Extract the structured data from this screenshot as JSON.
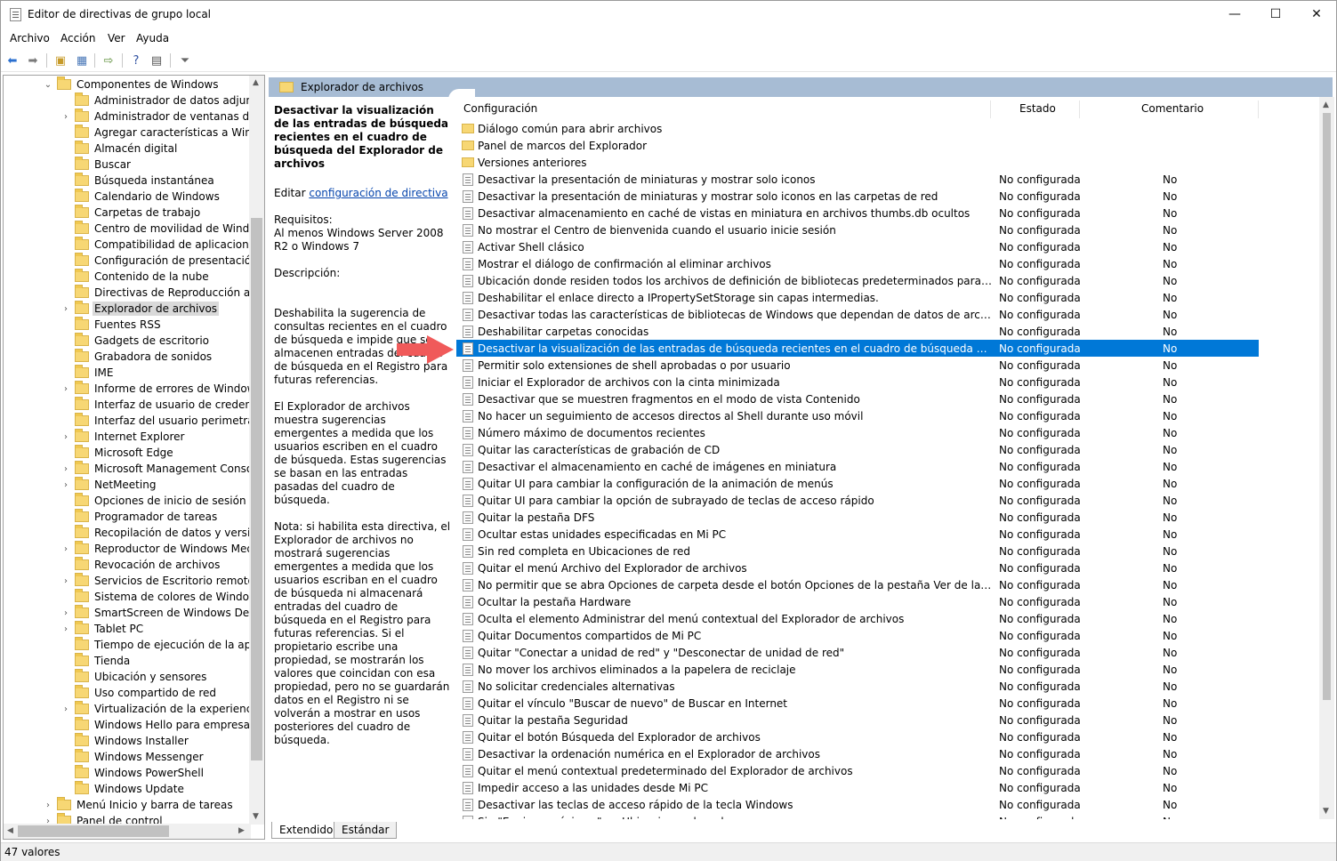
{
  "window": {
    "title": "Editor de directivas de grupo local",
    "minimize": "—",
    "maximize": "☐",
    "close": "✕"
  },
  "menu": [
    "Archivo",
    "Acción",
    "Ver",
    "Ayuda"
  ],
  "tree": {
    "root": "Componentes de Windows",
    "items": [
      {
        "label": "Administrador de datos adjuntos",
        "expandable": false
      },
      {
        "label": "Administrador de ventanas del es",
        "expandable": true
      },
      {
        "label": "Agregar características a Window",
        "expandable": false
      },
      {
        "label": "Almacén digital",
        "expandable": false
      },
      {
        "label": "Buscar",
        "expandable": false
      },
      {
        "label": "Búsqueda instantánea",
        "expandable": false
      },
      {
        "label": "Calendario de Windows",
        "expandable": false
      },
      {
        "label": "Carpetas de trabajo",
        "expandable": false
      },
      {
        "label": "Centro de movilidad de Windows",
        "expandable": false
      },
      {
        "label": "Compatibilidad de aplicaciones",
        "expandable": false
      },
      {
        "label": "Configuración de presentación",
        "expandable": false
      },
      {
        "label": "Contenido de la nube",
        "expandable": false
      },
      {
        "label": "Directivas de Reproducción autor",
        "expandable": false
      },
      {
        "label": "Explorador de archivos",
        "expandable": true,
        "selected": true
      },
      {
        "label": "Fuentes RSS",
        "expandable": false
      },
      {
        "label": "Gadgets de escritorio",
        "expandable": false
      },
      {
        "label": "Grabadora de sonidos",
        "expandable": false
      },
      {
        "label": "IME",
        "expandable": false
      },
      {
        "label": "Informe de errores de Windows",
        "expandable": true
      },
      {
        "label": "Interfaz de usuario de credenciale",
        "expandable": false
      },
      {
        "label": "Interfaz del usuario perimetral",
        "expandable": false
      },
      {
        "label": "Internet Explorer",
        "expandable": true
      },
      {
        "label": "Microsoft Edge",
        "expandable": false
      },
      {
        "label": "Microsoft Management Console",
        "expandable": true
      },
      {
        "label": "NetMeeting",
        "expandable": true
      },
      {
        "label": "Opciones de inicio de sesión de V",
        "expandable": false
      },
      {
        "label": "Programador de tareas",
        "expandable": false
      },
      {
        "label": "Recopilación de datos y versiones",
        "expandable": false
      },
      {
        "label": "Reproductor de Windows Media",
        "expandable": true
      },
      {
        "label": "Revocación de archivos",
        "expandable": false
      },
      {
        "label": "Servicios de Escritorio remoto",
        "expandable": true
      },
      {
        "label": "Sistema de colores de Windows",
        "expandable": false
      },
      {
        "label": "SmartScreen de Windows Defend",
        "expandable": true
      },
      {
        "label": "Tablet PC",
        "expandable": true
      },
      {
        "label": "Tiempo de ejecución de la aplicac",
        "expandable": false
      },
      {
        "label": "Tienda",
        "expandable": false
      },
      {
        "label": "Ubicación y sensores",
        "expandable": false
      },
      {
        "label": "Uso compartido de red",
        "expandable": false
      },
      {
        "label": "Virtualización de la experiencia de",
        "expandable": true
      },
      {
        "label": "Windows Hello para empresas",
        "expandable": false
      },
      {
        "label": "Windows Installer",
        "expandable": false
      },
      {
        "label": "Windows Messenger",
        "expandable": false
      },
      {
        "label": "Windows PowerShell",
        "expandable": false
      },
      {
        "label": "Windows Update",
        "expandable": false
      }
    ],
    "siblings": [
      "Menú Inicio y barra de tareas",
      "Panel de control"
    ]
  },
  "header": {
    "title": "Explorador de archivos"
  },
  "description": {
    "title": "Desactivar la visualización de las entradas de búsqueda recientes en el cuadro de búsqueda del Explorador de archivos",
    "edit_prefix": "Editar ",
    "edit_link": "configuración de directiva",
    "req_label": "Requisitos:",
    "req_text": "Al menos Windows Server 2008 R2 o Windows 7",
    "desc_label": "Descripción:",
    "p1": "Deshabilita la sugerencia de consultas recientes en el cuadro de búsqueda e impide que se almacenen entradas del cuadro de búsqueda en el Registro para futuras referencias.",
    "p2": "El Explorador de archivos muestra sugerencias emergentes a medida que los usuarios escriben en el cuadro de búsqueda.  Estas sugerencias se basan en las entradas pasadas del cuadro de búsqueda.",
    "p3": "Nota: si habilita esta directiva, el Explorador de archivos no mostrará sugerencias emergentes a medida que los usuarios escriban en el cuadro de búsqueda ni almacenará entradas del cuadro de búsqueda en el Registro para futuras referencias.  Si el propietario escribe una propiedad, se mostrarán los valores que coincidan con esa propiedad, pero no se guardarán datos en el Registro ni se volverán a mostrar en usos posteriores del cuadro de búsqueda."
  },
  "columns": {
    "config": "Configuración",
    "estado": "Estado",
    "comentario": "Comentario"
  },
  "folders": [
    "Diálogo común para abrir archivos",
    "Panel de marcos del Explorador",
    "Versiones anteriores"
  ],
  "policies": [
    {
      "name": "Desactivar la presentación de miniaturas y mostrar solo iconos",
      "estado": "No configurada",
      "coment": "No"
    },
    {
      "name": "Desactivar la presentación de miniaturas y mostrar solo iconos en las carpetas de red",
      "estado": "No configurada",
      "coment": "No"
    },
    {
      "name": "Desactivar almacenamiento en caché de vistas en miniatura en archivos thumbs.db ocultos",
      "estado": "No configurada",
      "coment": "No"
    },
    {
      "name": "No mostrar el Centro de bienvenida cuando el usuario inicie sesión",
      "estado": "No configurada",
      "coment": "No"
    },
    {
      "name": "Activar Shell clásico",
      "estado": "No configurada",
      "coment": "No"
    },
    {
      "name": "Mostrar el diálogo de confirmación al eliminar archivos",
      "estado": "No configurada",
      "coment": "No"
    },
    {
      "name": "Ubicación donde residen todos los archivos de definición de bibliotecas predeterminados para usuarios o e...",
      "estado": "No configurada",
      "coment": "No"
    },
    {
      "name": "Deshabilitar el enlace directo a IPropertySetStorage sin capas intermedias.",
      "estado": "No configurada",
      "coment": "No"
    },
    {
      "name": "Desactivar todas las características de bibliotecas de Windows que dependan de datos de archivos indizados",
      "estado": "No configurada",
      "coment": "No"
    },
    {
      "name": "Deshabilitar carpetas conocidas",
      "estado": "No configurada",
      "coment": "No"
    },
    {
      "name": "Desactivar la visualización de las entradas de búsqueda recientes en el cuadro de búsqueda del Explorador d...",
      "estado": "No configurada",
      "coment": "No",
      "selected": true
    },
    {
      "name": "Permitir solo extensiones de shell aprobadas o por usuario",
      "estado": "No configurada",
      "coment": "No"
    },
    {
      "name": "Iniciar el Explorador de archivos con la cinta minimizada",
      "estado": "No configurada",
      "coment": "No"
    },
    {
      "name": "Desactivar que se muestren fragmentos en el modo de vista Contenido",
      "estado": "No configurada",
      "coment": "No"
    },
    {
      "name": "No hacer un seguimiento de accesos directos al Shell durante uso móvil",
      "estado": "No configurada",
      "coment": "No"
    },
    {
      "name": "Número máximo de documentos recientes",
      "estado": "No configurada",
      "coment": "No"
    },
    {
      "name": "Quitar las características de grabación de CD",
      "estado": "No configurada",
      "coment": "No"
    },
    {
      "name": "Desactivar el almacenamiento en caché de imágenes en miniatura",
      "estado": "No configurada",
      "coment": "No"
    },
    {
      "name": "Quitar UI para cambiar la configuración de la animación de menús",
      "estado": "No configurada",
      "coment": "No"
    },
    {
      "name": "Quitar UI para cambiar la opción de subrayado de teclas de acceso rápido",
      "estado": "No configurada",
      "coment": "No"
    },
    {
      "name": "Quitar la pestaña DFS",
      "estado": "No configurada",
      "coment": "No"
    },
    {
      "name": "Ocultar estas unidades especificadas en Mi PC",
      "estado": "No configurada",
      "coment": "No"
    },
    {
      "name": "Sin red completa en Ubicaciones de red",
      "estado": "No configurada",
      "coment": "No"
    },
    {
      "name": "Quitar el menú Archivo del Explorador de archivos",
      "estado": "No configurada",
      "coment": "No"
    },
    {
      "name": "No permitir que se abra Opciones de carpeta desde el botón Opciones de la pestaña Ver de la cinta",
      "estado": "No configurada",
      "coment": "No"
    },
    {
      "name": "Ocultar la pestaña Hardware",
      "estado": "No configurada",
      "coment": "No"
    },
    {
      "name": "Oculta el elemento Administrar del menú contextual del Explorador de archivos",
      "estado": "No configurada",
      "coment": "No"
    },
    {
      "name": "Quitar Documentos compartidos de Mi PC",
      "estado": "No configurada",
      "coment": "No"
    },
    {
      "name": "Quitar \"Conectar a unidad de red\" y \"Desconectar de unidad de red\"",
      "estado": "No configurada",
      "coment": "No"
    },
    {
      "name": "No mover los archivos eliminados a la papelera de reciclaje",
      "estado": "No configurada",
      "coment": "No"
    },
    {
      "name": "No solicitar credenciales alternativas",
      "estado": "No configurada",
      "coment": "No"
    },
    {
      "name": "Quitar el vínculo \"Buscar de nuevo\" de Buscar en Internet",
      "estado": "No configurada",
      "coment": "No"
    },
    {
      "name": "Quitar la pestaña Seguridad",
      "estado": "No configurada",
      "coment": "No"
    },
    {
      "name": "Quitar el botón Búsqueda del Explorador de archivos",
      "estado": "No configurada",
      "coment": "No"
    },
    {
      "name": "Desactivar la ordenación numérica en el Explorador de archivos",
      "estado": "No configurada",
      "coment": "No"
    },
    {
      "name": "Quitar el menú contextual predeterminado del Explorador de archivos",
      "estado": "No configurada",
      "coment": "No"
    },
    {
      "name": "Impedir acceso a las unidades desde Mi PC",
      "estado": "No configurada",
      "coment": "No"
    },
    {
      "name": "Desactivar las teclas de acceso rápido de la tecla Windows",
      "estado": "No configurada",
      "coment": "No"
    },
    {
      "name": "Sin \"Equipos próximos\" en Ubicaciones de red",
      "estado": "No configurada",
      "coment": "No"
    }
  ],
  "tabs": [
    "Extendido",
    "Estándar"
  ],
  "status": "47 valores",
  "colors": {
    "selection": "#0078d7",
    "header_band": "#a7bcd4",
    "folder": "#f7d774",
    "arrow": "#f05a5a"
  }
}
